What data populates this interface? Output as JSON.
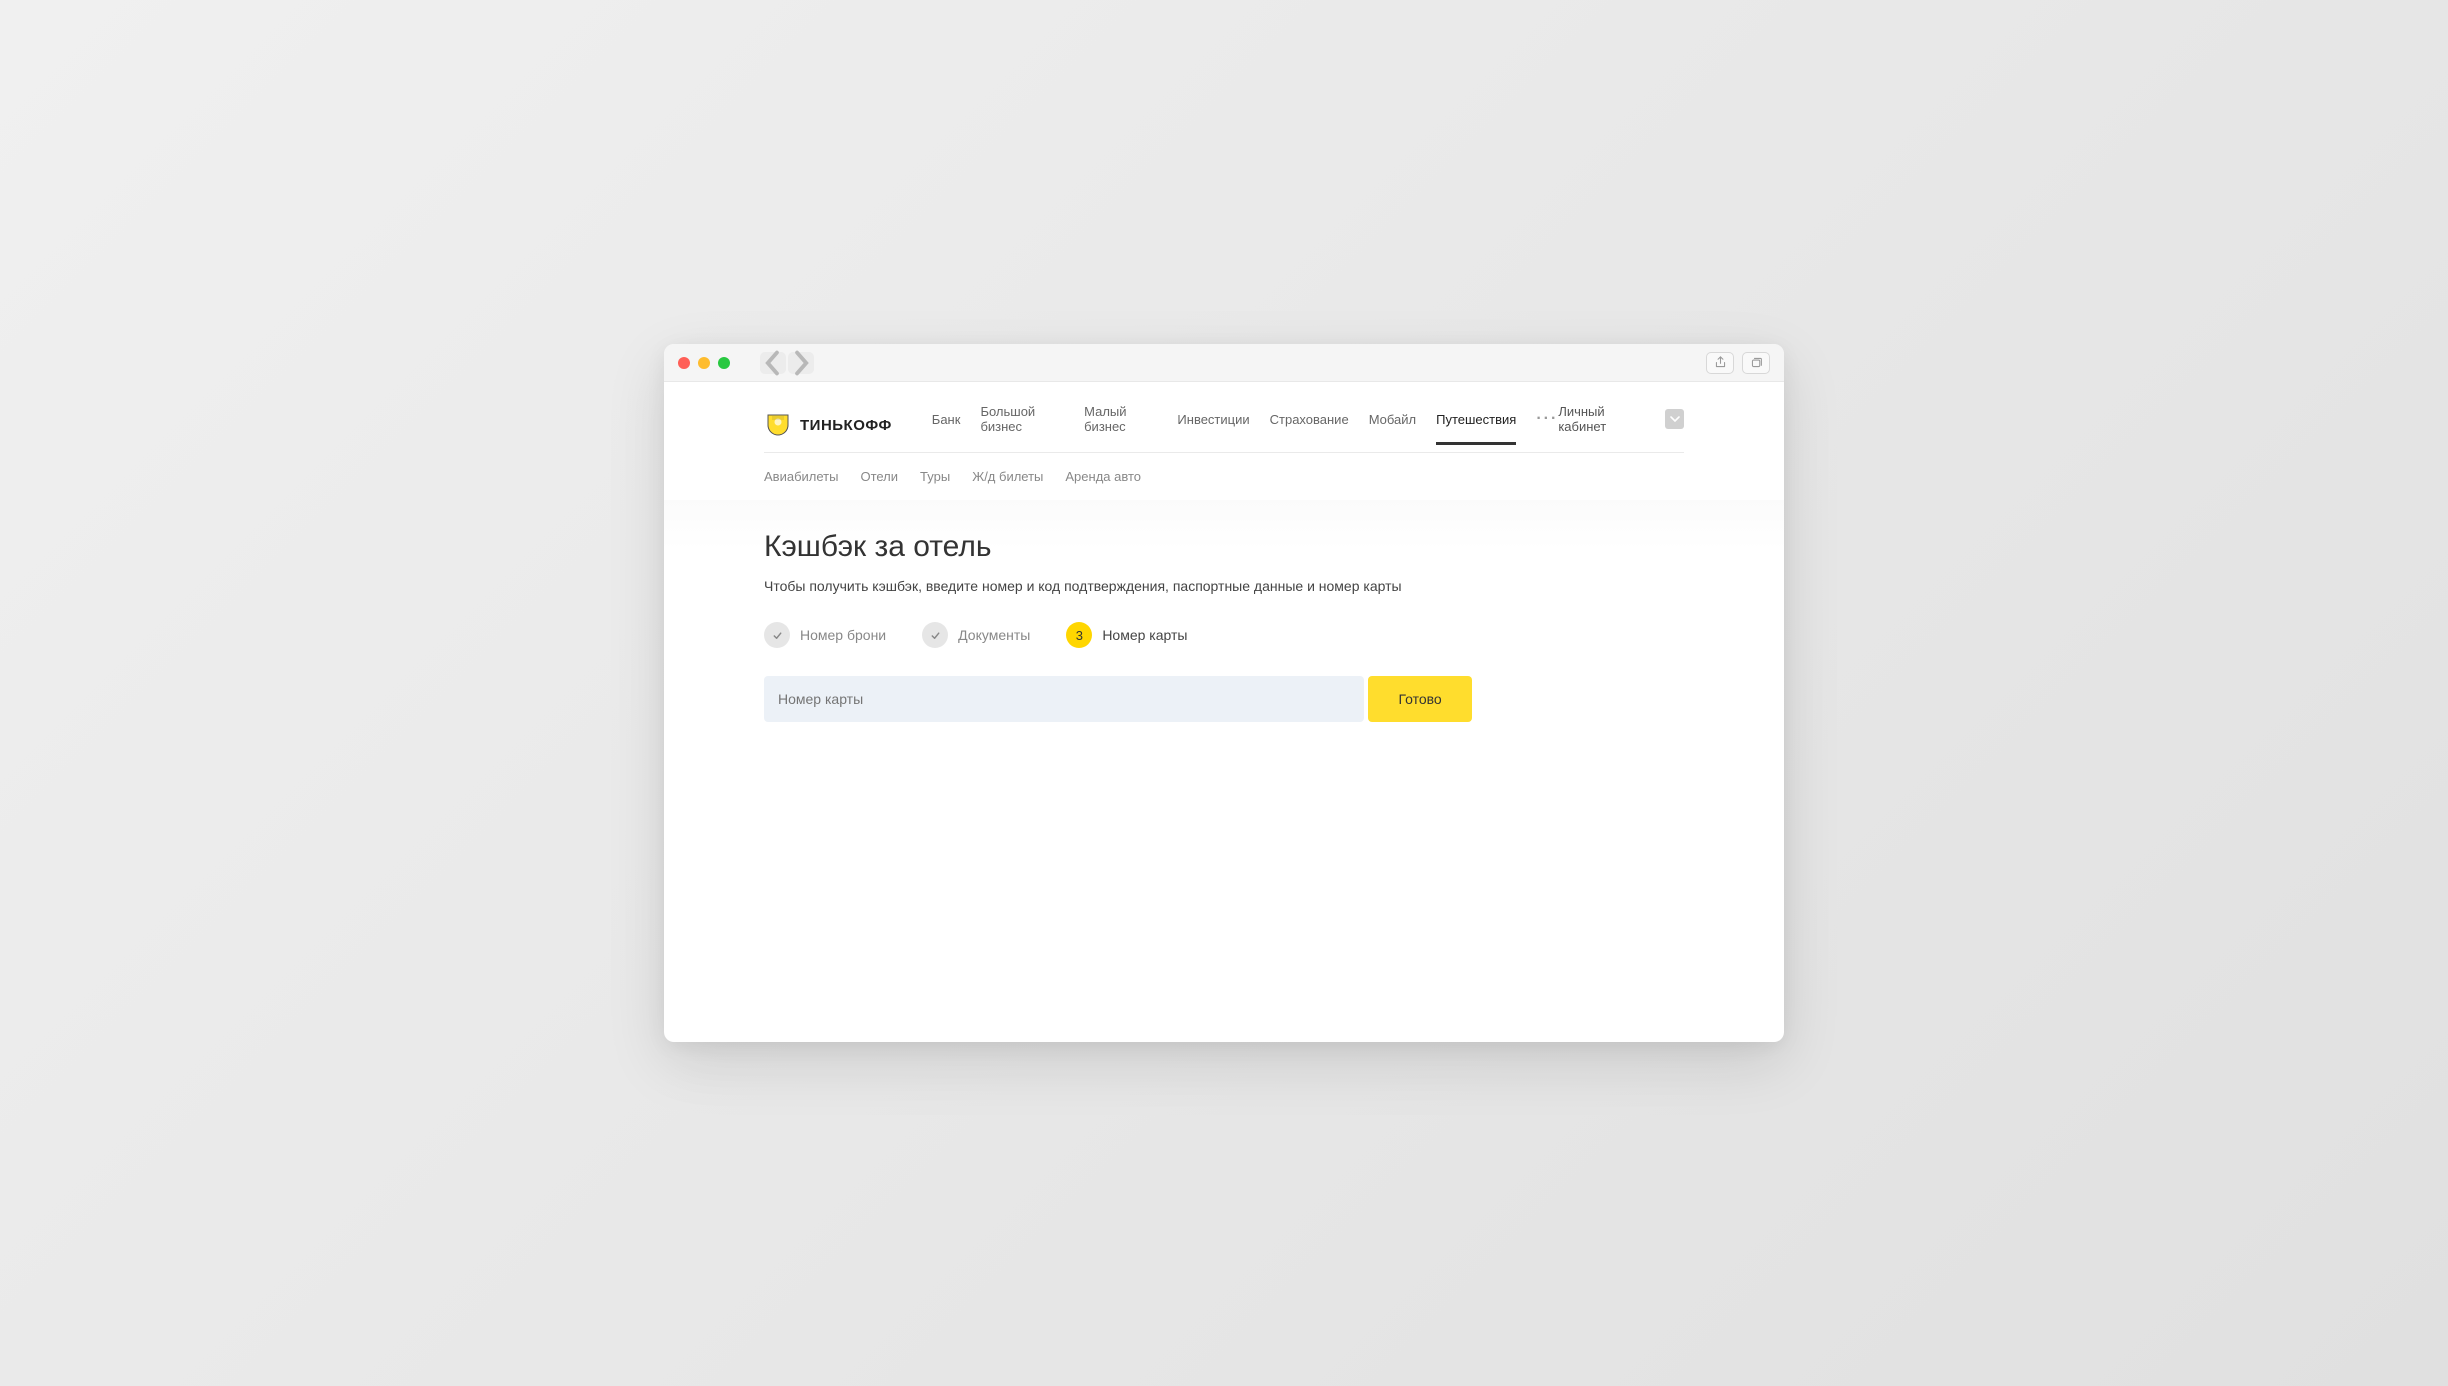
{
  "brand": "ТИНЬКОФФ",
  "main_nav": {
    "items": [
      "Банк",
      "Большой бизнес",
      "Малый бизнес",
      "Инвестиции",
      "Страхование",
      "Мобайл",
      "Путешествия"
    ],
    "active_index": 6,
    "more": "···"
  },
  "account": {
    "link": "Личный кабинет"
  },
  "subnav": {
    "items": [
      "Авиабилеты",
      "Отели",
      "Туры",
      "Ж/д билеты",
      "Аренда авто"
    ]
  },
  "page": {
    "title": "Кэшбэк за отель",
    "subtitle": "Чтобы получить кэшбэк, введите номер и код подтверждения, паспортные данные и номер карты"
  },
  "stepper": {
    "step1": {
      "label": "Номер брони",
      "state": "done"
    },
    "step2": {
      "label": "Документы",
      "state": "done"
    },
    "step3": {
      "number": "3",
      "label": "Номер карты",
      "state": "active"
    }
  },
  "form": {
    "card_placeholder": "Номер карты",
    "submit_label": "Готово"
  }
}
